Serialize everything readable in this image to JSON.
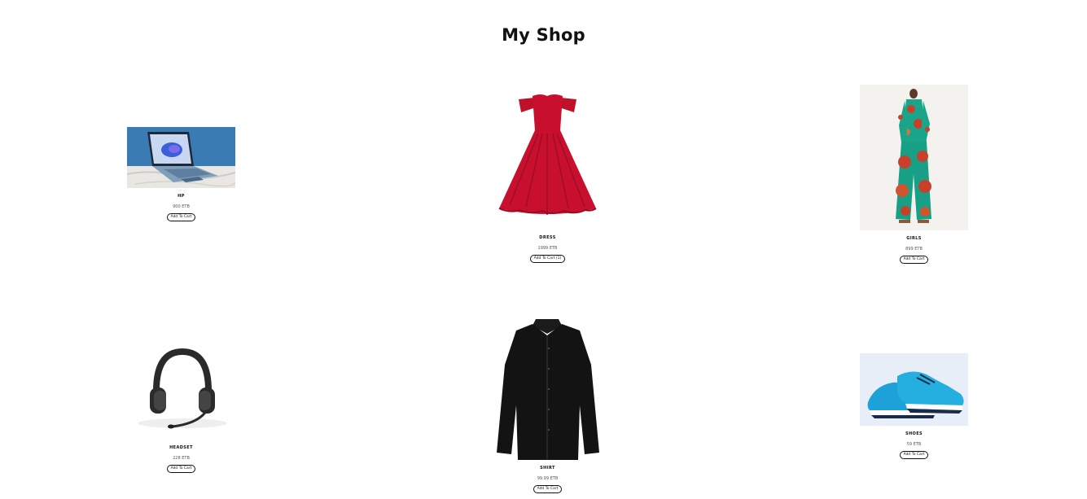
{
  "header": {
    "title": "My Shop"
  },
  "products": [
    {
      "name": "HP",
      "price": "900 ETB",
      "button": "Add To Cart",
      "image": "laptop-image"
    },
    {
      "name": "DRESS",
      "price": "1999 ETB",
      "button": "Add To Cart (1)",
      "image": "red-dress-image"
    },
    {
      "name": "GIRLS",
      "price": "899 ETB",
      "button": "Add To Cart",
      "image": "patterned-outfit-image"
    },
    {
      "name": "HEADSET",
      "price": "228 ETB",
      "button": "Add To Cart",
      "image": "headset-image"
    },
    {
      "name": "SHIRT",
      "price": "99.99 ETB",
      "button": "Add To Cart",
      "image": "black-shirt-image"
    },
    {
      "name": "SHOES",
      "price": "59 ETB",
      "button": "Add To Cart",
      "image": "blue-sneakers-image"
    }
  ]
}
